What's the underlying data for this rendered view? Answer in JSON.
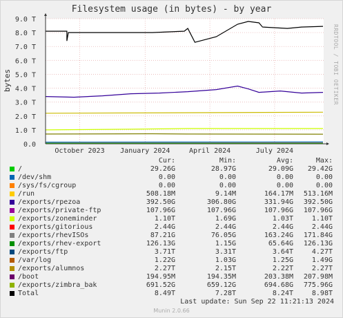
{
  "chart_data": {
    "type": "line",
    "title": "Filesystem usage (in bytes) - by year",
    "ylabel": "bytes",
    "ylim": [
      0,
      9
    ],
    "yticks": [
      "0.0",
      "1.0 T",
      "2.0 T",
      "3.0 T",
      "4.0 T",
      "5.0 T",
      "6.0 T",
      "7.0 T",
      "8.0 T",
      "9.0 T"
    ],
    "xlim": [
      "2023-08-28",
      "2024-09-22"
    ],
    "xticks": [
      {
        "label": "October 2023",
        "date": "2023-10-15"
      },
      {
        "label": "January 2024",
        "date": "2024-01-15"
      },
      {
        "label": "April 2024",
        "date": "2024-04-15"
      },
      {
        "label": "July 2024",
        "date": "2024-07-15"
      }
    ],
    "series": [
      {
        "name": "/",
        "color": "#00cc00",
        "values": [
          [
            0,
            0.03
          ],
          [
            390,
            0.03
          ]
        ]
      },
      {
        "name": "/exports/private-ftp",
        "color": "#cc0000",
        "values": [
          [
            0,
            0.11
          ],
          [
            390,
            0.11
          ]
        ]
      },
      {
        "name": "/exports/zoneminder",
        "color": "#ccff00",
        "values": [
          [
            0,
            1.0
          ],
          [
            120,
            1.05
          ],
          [
            200,
            1.1
          ],
          [
            300,
            1.1
          ],
          [
            390,
            1.1
          ]
        ]
      },
      {
        "name": "/exports/rhev-export",
        "color": "#0066b3",
        "values": [
          [
            0,
            0.12
          ],
          [
            390,
            0.13
          ]
        ]
      },
      {
        "name": "/exports/ftp",
        "color": "#330099",
        "values": [
          [
            0,
            3.4
          ],
          [
            40,
            3.35
          ],
          [
            80,
            3.45
          ],
          [
            120,
            3.6
          ],
          [
            160,
            3.65
          ],
          [
            200,
            3.75
          ],
          [
            240,
            3.9
          ],
          [
            270,
            4.15
          ],
          [
            285,
            3.95
          ],
          [
            300,
            3.7
          ],
          [
            330,
            3.8
          ],
          [
            360,
            3.65
          ],
          [
            390,
            3.7
          ]
        ]
      },
      {
        "name": "/exports/alumnos",
        "color": "#ccbb00",
        "values": [
          [
            0,
            2.2
          ],
          [
            390,
            2.27
          ]
        ]
      },
      {
        "name": "/exports/zimbra_bak",
        "color": "#808000",
        "values": [
          [
            0,
            0.7
          ],
          [
            150,
            0.72
          ],
          [
            200,
            0.7
          ],
          [
            390,
            0.69
          ]
        ]
      },
      {
        "name": "Total",
        "color": "#000000",
        "values": [
          [
            0,
            8.1
          ],
          [
            30,
            8.1
          ],
          [
            30,
            7.4
          ],
          [
            32,
            8.0
          ],
          [
            120,
            8.0
          ],
          [
            150,
            8.0
          ],
          [
            195,
            8.1
          ],
          [
            200,
            8.3
          ],
          [
            210,
            7.3
          ],
          [
            240,
            7.7
          ],
          [
            270,
            8.6
          ],
          [
            285,
            8.8
          ],
          [
            300,
            8.7
          ],
          [
            305,
            8.4
          ],
          [
            340,
            8.3
          ],
          [
            360,
            8.4
          ],
          [
            390,
            8.45
          ]
        ]
      }
    ]
  },
  "legend": {
    "headers": {
      "cur": "Cur:",
      "min": "Min:",
      "avg": "Avg:",
      "max": "Max:"
    },
    "rows": [
      {
        "name": "/",
        "color": "#00cc00",
        "cur": "29.26G",
        "min": "28.97G",
        "avg": "29.09G",
        "max": "29.42G"
      },
      {
        "name": "/dev/shm",
        "color": "#0066b3",
        "cur": "0.00",
        "min": "0.00",
        "avg": "0.00",
        "max": "0.00"
      },
      {
        "name": "/sys/fs/cgroup",
        "color": "#ff8000",
        "cur": "0.00",
        "min": "0.00",
        "avg": "0.00",
        "max": "0.00"
      },
      {
        "name": "/run",
        "color": "#ffcc00",
        "cur": "508.18M",
        "min": "9.14M",
        "avg": "164.17M",
        "max": "513.16M"
      },
      {
        "name": "/exports/rpezoa",
        "color": "#330099",
        "cur": "392.50G",
        "min": "306.80G",
        "avg": "331.94G",
        "max": "392.50G"
      },
      {
        "name": "/exports/private-ftp",
        "color": "#990099",
        "cur": "107.96G",
        "min": "107.96G",
        "avg": "107.96G",
        "max": "107.96G"
      },
      {
        "name": "/exports/zoneminder",
        "color": "#ccff00",
        "cur": "1.10T",
        "min": "1.69G",
        "avg": "1.03T",
        "max": "1.10T"
      },
      {
        "name": "/exports/gitorious",
        "color": "#ff0000",
        "cur": "2.44G",
        "min": "2.44G",
        "avg": "2.44G",
        "max": "2.44G"
      },
      {
        "name": "/exports/rhevISOs",
        "color": "#808080",
        "cur": "87.21G",
        "min": "76.05G",
        "avg": "163.24G",
        "max": "171.84G"
      },
      {
        "name": "/exports/rhev-export",
        "color": "#008f00",
        "cur": "126.13G",
        "min": "1.15G",
        "avg": "65.64G",
        "max": "126.13G"
      },
      {
        "name": "/exports/ftp",
        "color": "#00487d",
        "cur": "3.71T",
        "min": "3.31T",
        "avg": "3.64T",
        "max": "4.27T"
      },
      {
        "name": "/var/log",
        "color": "#b35a00",
        "cur": "1.22G",
        "min": "1.03G",
        "avg": "1.25G",
        "max": "1.49G"
      },
      {
        "name": "/exports/alumnos",
        "color": "#b38f00",
        "cur": "2.27T",
        "min": "2.15T",
        "avg": "2.22T",
        "max": "2.27T"
      },
      {
        "name": "/boot",
        "color": "#6b006b",
        "cur": "194.95M",
        "min": "194.35M",
        "avg": "203.38M",
        "max": "207.98M"
      },
      {
        "name": "/exports/zimbra_bak",
        "color": "#8fb300",
        "cur": "691.52G",
        "min": "659.12G",
        "avg": "694.68G",
        "max": "775.96G"
      },
      {
        "name": "Total",
        "color": "#000000",
        "cur": "8.49T",
        "min": "7.28T",
        "avg": "8.24T",
        "max": "8.98T"
      }
    ]
  },
  "last_update": "Last update: Sun Sep 22 11:21:13 2024",
  "watermark": "RRDTOOL / TOBI OETIKER",
  "footer": "Munin 2.0.66"
}
